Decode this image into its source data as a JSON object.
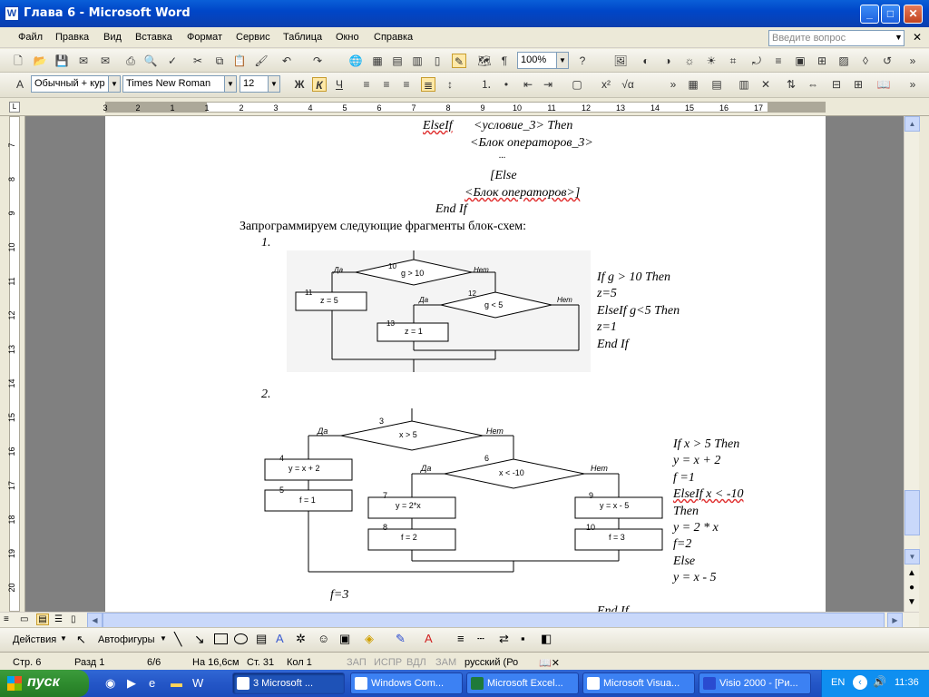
{
  "window": {
    "title": "Глава 6 - Microsoft Word",
    "controls": [
      "minimize",
      "maximize",
      "close"
    ]
  },
  "menu": {
    "items": [
      "Файл",
      "Правка",
      "Вид",
      "Вставка",
      "Формат",
      "Сервис",
      "Таблица",
      "Окно",
      "Справка"
    ],
    "help_placeholder": "Введите вопрос"
  },
  "toolbar_standard": {
    "zoom": "100%"
  },
  "toolbar_format": {
    "style": "Обычный + кур",
    "font": "Times New Roman",
    "size": "12",
    "bold": "Ж",
    "italic": "К",
    "underline": "Ч"
  },
  "ruler": {
    "top_numbers": [
      "3",
      "2",
      "1",
      "1",
      "2",
      "3",
      "4",
      "5",
      "6",
      "7",
      "8",
      "9",
      "10",
      "11",
      "12",
      "13",
      "14",
      "15",
      "16",
      "17"
    ],
    "left_numbers": [
      "7",
      "8",
      "9",
      "10",
      "11",
      "12",
      "13",
      "14",
      "15",
      "16",
      "17",
      "18",
      "19",
      "20"
    ]
  },
  "document": {
    "code1": {
      "elseif": "ElseIf",
      "cond3": "<условие_3> Then",
      "block3": "<Блок операторов_3>",
      "dots": "...",
      "else": "[Else",
      "block": "<Блок операторов>]",
      "endif": "End If"
    },
    "intro": "Запрограммируем следующие фрагменты блок-схем:",
    "item1": "1.",
    "flow1": {
      "cond_a": "g > 10",
      "num_a": "10",
      "yes": "Да",
      "no": "Нет",
      "cond_b": "g < 5",
      "num_b": "12",
      "box11": "z = 5",
      "num11": "11",
      "box13": "z = 1",
      "num13": "13"
    },
    "code2": [
      "If g > 10 Then",
      "z=5",
      "ElseIf g<5 Then",
      "z=1",
      "End If"
    ],
    "item2": "2.",
    "flow2": {
      "num3": "3",
      "cond3": "x > 5",
      "num6": "6",
      "cond6": "x < -10",
      "yes": "Да",
      "no": "Нет",
      "num4": "4",
      "box4": "y = x + 2",
      "num5": "5",
      "box5": "f = 1",
      "num7": "7",
      "box7": "y = 2*x",
      "num8": "8",
      "box8": "f = 2",
      "num9": "9",
      "box9": "y = x - 5",
      "num10": "10",
      "box10": "f = 3"
    },
    "code3": [
      "If x > 5 Then",
      "y = x + 2",
      "f =1",
      "ElseIf  x  <  -10",
      "Then",
      "y = 2 * x",
      "f=2",
      "Else",
      "y = x - 5"
    ],
    "f3": "f=3",
    "endif_bottom": "End If"
  },
  "drawing_toolbar": {
    "actions": "Действия",
    "autoshapes": "Автофигуры"
  },
  "status": {
    "page": "Стр. 6",
    "section": "Разд 1",
    "pages": "6/6",
    "at": "На 16,6см",
    "line": "Ст. 31",
    "col": "Кол 1",
    "rec": "ЗАП",
    "trk": "ИСПР",
    "ext": "ВДЛ",
    "ovr": "ЗАМ",
    "lang": "русский (Ро"
  },
  "taskbar": {
    "start": "пуск",
    "tasks": [
      "3 Microsoft ...",
      "Windows Com...",
      "Microsoft Excel...",
      "Microsoft Visua...",
      "Visio 2000 - [Ри..."
    ],
    "lang": "EN",
    "time": "11:36"
  }
}
